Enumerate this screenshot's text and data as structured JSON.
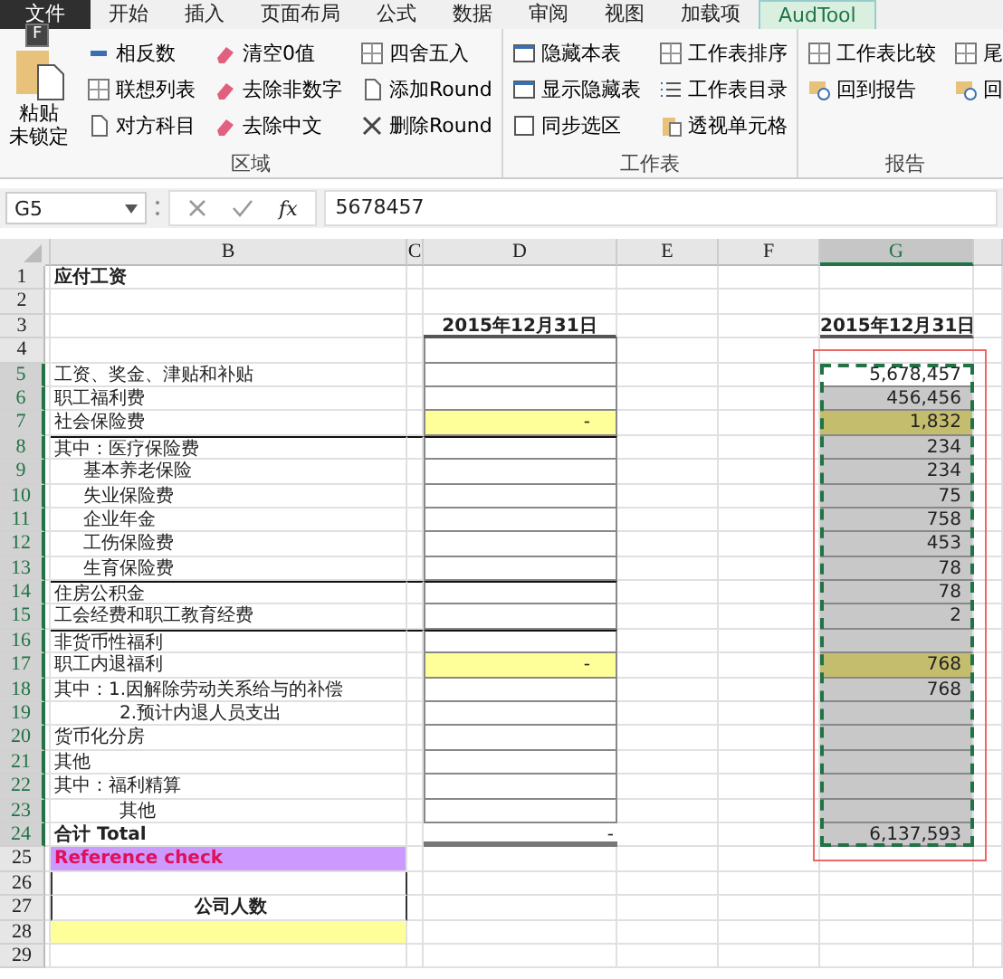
{
  "file_tab": {
    "label": "文件",
    "key_tip": "F"
  },
  "tabs": [
    {
      "label": "开始",
      "selected": false
    },
    {
      "label": "插入",
      "selected": false
    },
    {
      "label": "页面布局",
      "selected": false
    },
    {
      "label": "公式",
      "selected": false
    },
    {
      "label": "数据",
      "selected": false
    },
    {
      "label": "审阅",
      "selected": false
    },
    {
      "label": "视图",
      "selected": false
    },
    {
      "label": "加载项",
      "selected": false
    },
    {
      "label": "AudTool",
      "selected": true
    }
  ],
  "ribbon": {
    "groups": [
      {
        "label": "区域",
        "large": [
          "粘贴",
          "未锁定"
        ],
        "columns": [
          [
            "相反数",
            "联想列表",
            "对方科目"
          ],
          [
            "清空0值",
            "去除非数字",
            "去除中文"
          ],
          [
            "四舍五入",
            "添加Round",
            "删除Round"
          ]
        ]
      },
      {
        "label": "工作表",
        "columns": [
          [
            "隐藏本表",
            "显示隐藏表",
            "同步选区"
          ],
          [
            "工作表排序",
            "工作表目录",
            "透视单元格"
          ]
        ]
      },
      {
        "label": "报告",
        "columns": [
          [
            "工作表比较",
            "回到报告"
          ],
          [
            "尾",
            "回"
          ]
        ]
      }
    ]
  },
  "formula_bar": {
    "name_box": "G5",
    "fx": "fx",
    "value": "5678457"
  },
  "columns": [
    {
      "label": "B",
      "selected": false
    },
    {
      "label": "C",
      "selected": false
    },
    {
      "label": "D",
      "selected": false
    },
    {
      "label": "E",
      "selected": false
    },
    {
      "label": "F",
      "selected": false
    },
    {
      "label": "G",
      "selected": true
    }
  ],
  "rows": [
    {
      "n": "1",
      "selected": false,
      "kind": "title",
      "b": {
        "text": "应付工资"
      }
    },
    {
      "n": "2",
      "selected": false,
      "kind": "blank"
    },
    {
      "n": "3",
      "selected": false,
      "kind": "header",
      "d": {
        "text": "2015年12月31日"
      },
      "g": {
        "text": "2015年12月31日"
      }
    },
    {
      "n": "4",
      "selected": false,
      "kind": "item"
    },
    {
      "n": "5",
      "selected": true,
      "kind": "item",
      "b": {
        "text": "工资、奖金、津贴和补贴"
      },
      "g": {
        "text": "5,678,457",
        "color": "#ffffff"
      }
    },
    {
      "n": "6",
      "selected": true,
      "kind": "item",
      "b": {
        "text": "职工福利费"
      },
      "g": {
        "text": "456,456",
        "color": "#c8c8c8"
      }
    },
    {
      "n": "7",
      "selected": true,
      "kind": "item",
      "b": {
        "text": "社会保险费"
      },
      "d": {
        "text": "-",
        "color": "#ffff99"
      },
      "g": {
        "text": "1,832",
        "color": "#c4bd6e"
      }
    },
    {
      "n": "8",
      "selected": true,
      "kind": "item",
      "rule": true,
      "b": {
        "text": "其中：医疗保险费"
      },
      "g": {
        "text": "234",
        "color": "#c8c8c8"
      }
    },
    {
      "n": "9",
      "selected": true,
      "kind": "item",
      "indented": true,
      "b": {
        "text": "基本养老保险"
      },
      "g": {
        "text": "234",
        "color": "#c8c8c8"
      }
    },
    {
      "n": "10",
      "selected": true,
      "kind": "item",
      "indented": true,
      "b": {
        "text": "失业保险费"
      },
      "g": {
        "text": "75",
        "color": "#c8c8c8"
      }
    },
    {
      "n": "11",
      "selected": true,
      "kind": "item",
      "indented": true,
      "b": {
        "text": "企业年金"
      },
      "g": {
        "text": "758",
        "color": "#c8c8c8"
      }
    },
    {
      "n": "12",
      "selected": true,
      "kind": "item",
      "indented": true,
      "b": {
        "text": "工伤保险费"
      },
      "g": {
        "text": "453",
        "color": "#c8c8c8"
      }
    },
    {
      "n": "13",
      "selected": true,
      "kind": "item",
      "indented": true,
      "b": {
        "text": "生育保险费"
      },
      "g": {
        "text": "78",
        "color": "#c8c8c8"
      }
    },
    {
      "n": "14",
      "selected": true,
      "kind": "item",
      "rule": true,
      "b": {
        "text": "住房公积金"
      },
      "g": {
        "text": "78",
        "color": "#c8c8c8"
      }
    },
    {
      "n": "15",
      "selected": true,
      "kind": "item",
      "b": {
        "text": "工会经费和职工教育经费"
      },
      "g": {
        "text": "2",
        "color": "#c8c8c8"
      }
    },
    {
      "n": "16",
      "selected": true,
      "kind": "item",
      "rule": true,
      "b": {
        "text": "非货币性福利"
      },
      "g": {
        "color": "#c8c8c8"
      }
    },
    {
      "n": "17",
      "selected": true,
      "kind": "item",
      "b": {
        "text": "职工内退福利"
      },
      "d": {
        "text": "-",
        "color": "#ffff99"
      },
      "g": {
        "text": "768",
        "color": "#c4bd6e"
      }
    },
    {
      "n": "18",
      "selected": true,
      "kind": "item",
      "b": {
        "text": "其中：1.因解除劳动关系给与的补偿"
      },
      "g": {
        "text": "768",
        "color": "#c8c8c8"
      }
    },
    {
      "n": "19",
      "selected": true,
      "kind": "item",
      "deep_indented": true,
      "b": {
        "text": "2.预计内退人员支出"
      },
      "g": {
        "color": "#c8c8c8"
      }
    },
    {
      "n": "20",
      "selected": true,
      "kind": "item",
      "b": {
        "text": "货币化分房"
      },
      "g": {
        "color": "#c8c8c8"
      }
    },
    {
      "n": "21",
      "selected": true,
      "kind": "item",
      "b": {
        "text": "其他"
      },
      "g": {
        "color": "#c8c8c8"
      }
    },
    {
      "n": "22",
      "selected": true,
      "kind": "item",
      "b": {
        "text": "其中：福利精算"
      },
      "g": {
        "color": "#c8c8c8"
      }
    },
    {
      "n": "23",
      "selected": true,
      "kind": "item",
      "deep_indented": true,
      "b": {
        "text": "其他"
      },
      "g": {
        "color": "#c8c8c8"
      }
    },
    {
      "n": "24",
      "selected": true,
      "kind": "total",
      "b": {
        "text": "合计 Total"
      },
      "d": {
        "text": "-"
      },
      "g": {
        "text": "6,137,593",
        "color": "#c8c8c8"
      }
    },
    {
      "n": "25",
      "selected": false,
      "kind": "check",
      "b": {
        "text": "Reference check",
        "color": "#cc99ff"
      }
    },
    {
      "n": "26",
      "selected": false,
      "kind": "boxed"
    },
    {
      "n": "27",
      "selected": false,
      "kind": "boxed",
      "b": {
        "text": "公司人数"
      }
    },
    {
      "n": "28",
      "selected": false,
      "kind": "blank",
      "b": {
        "color": "#ffff99"
      }
    },
    {
      "n": "29",
      "selected": false,
      "kind": "blank"
    }
  ]
}
